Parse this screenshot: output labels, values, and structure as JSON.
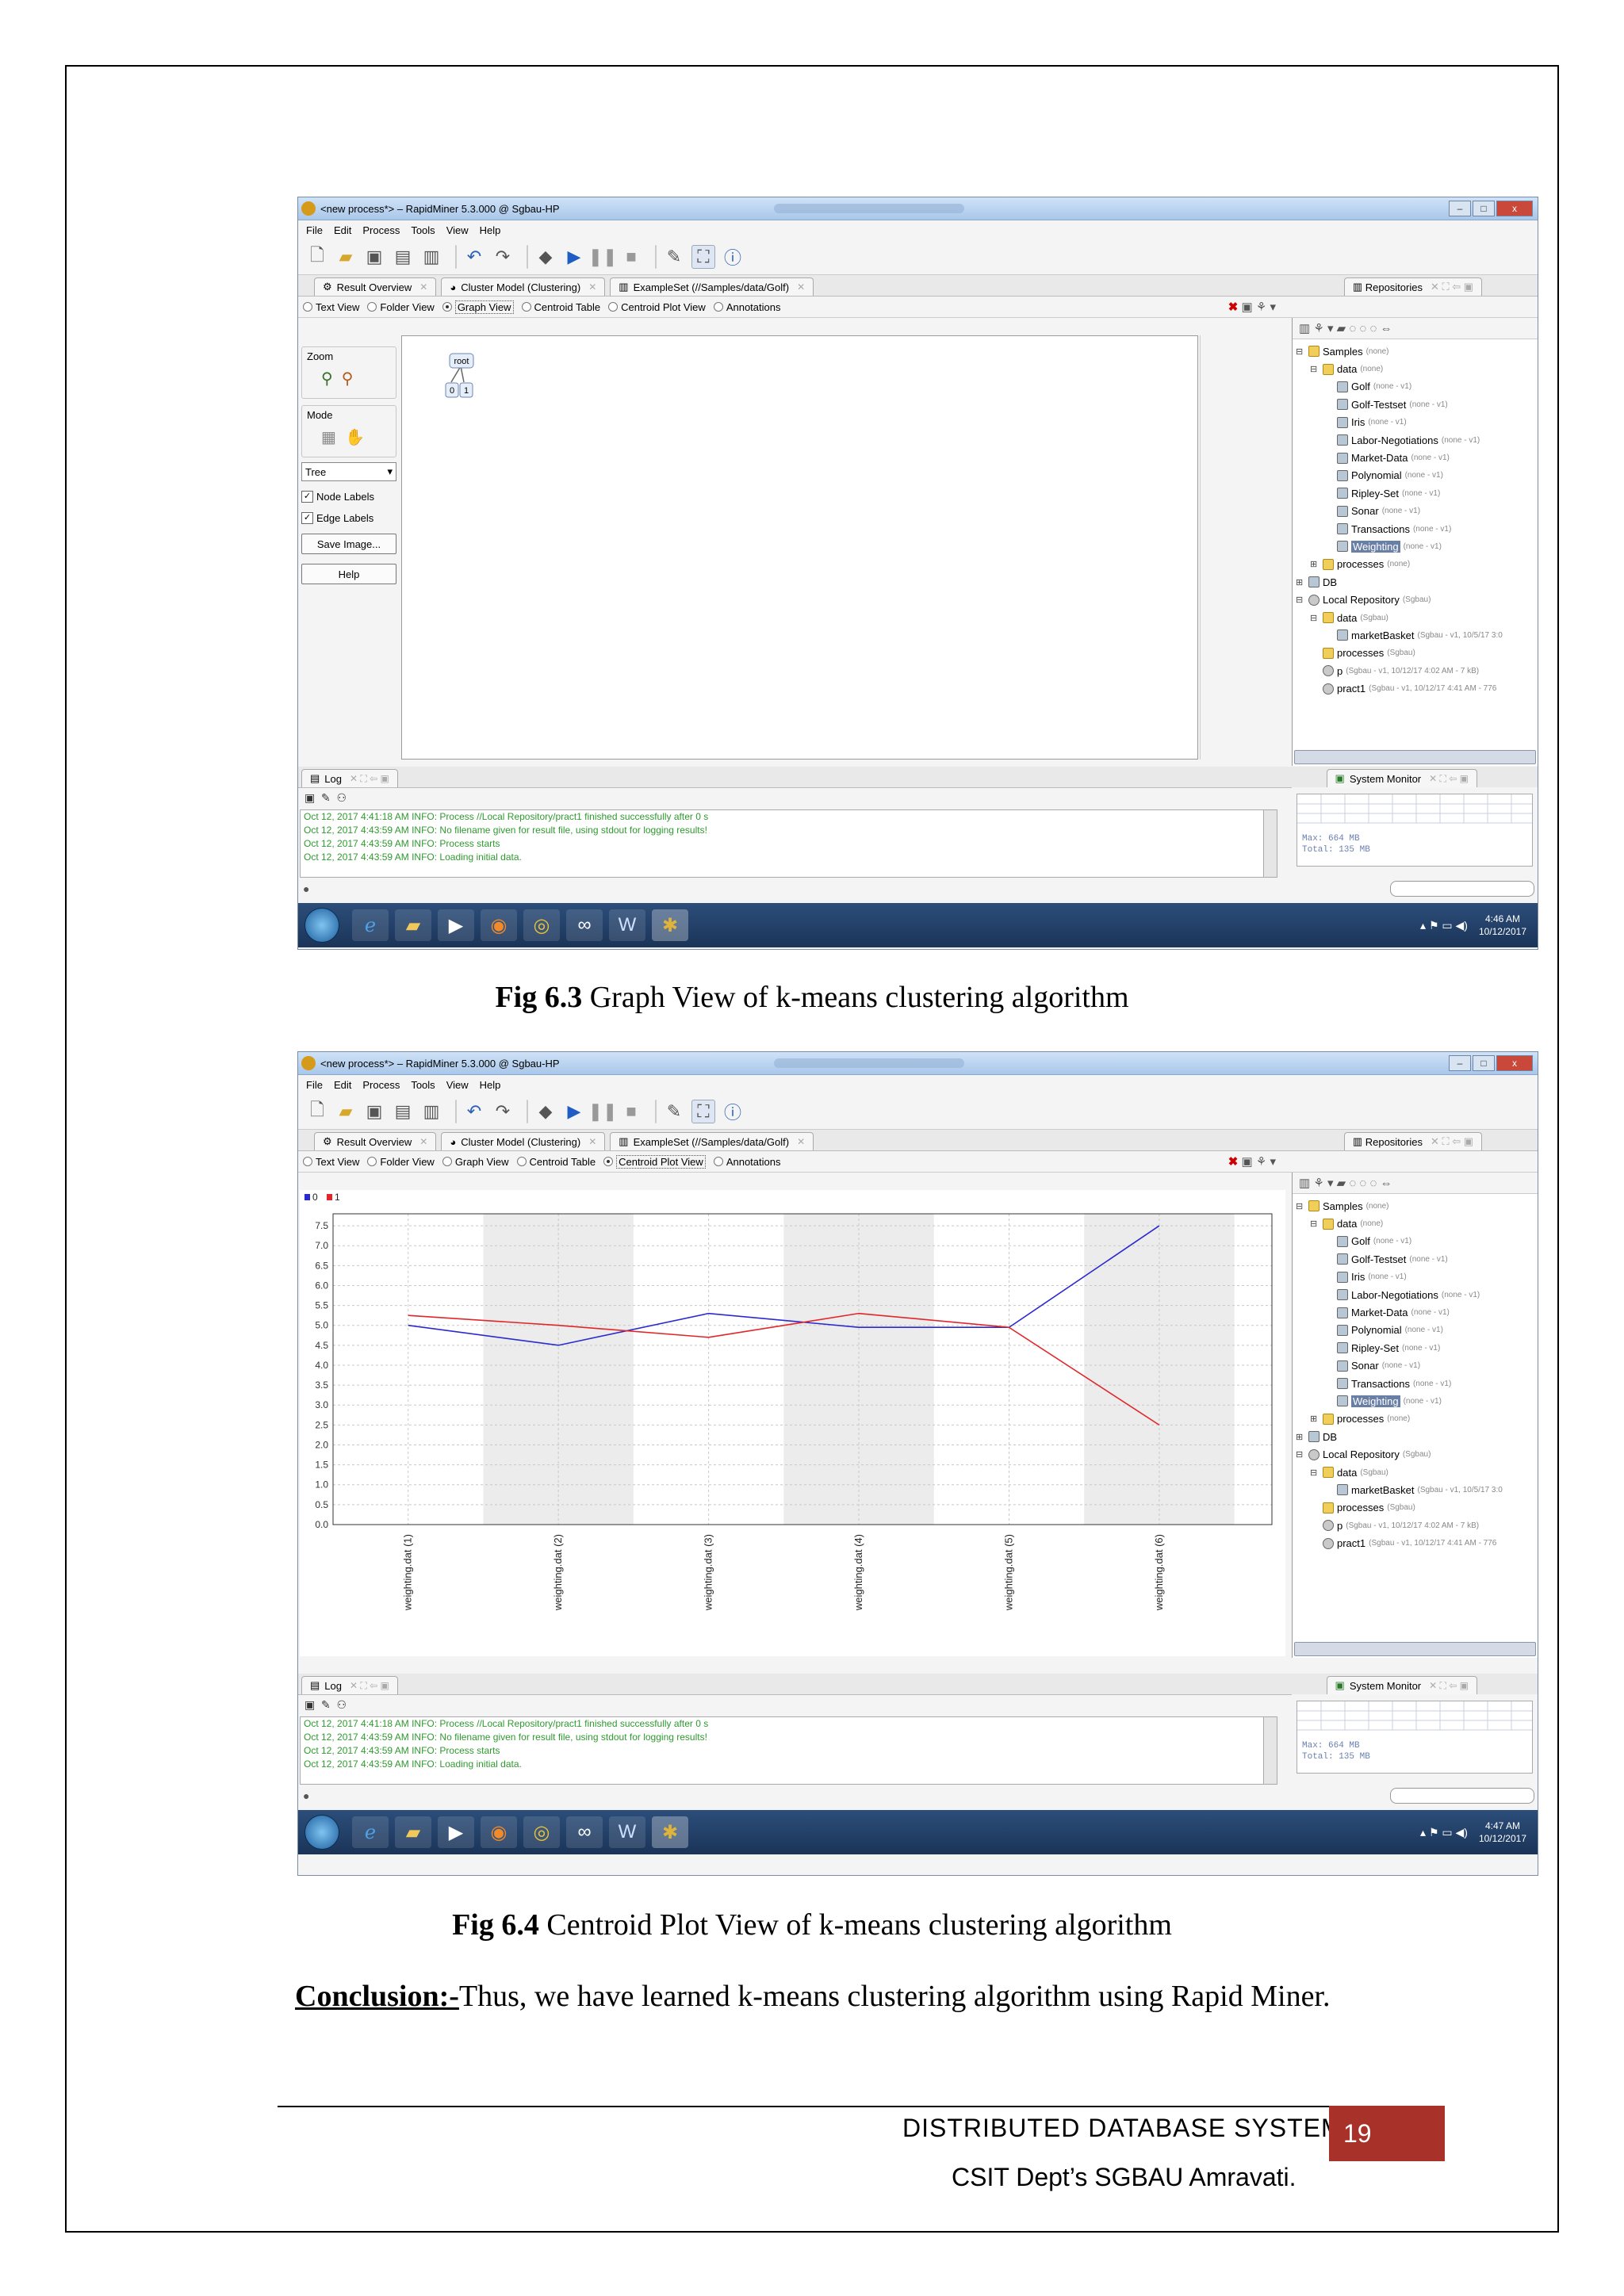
{
  "window": {
    "title": "<new process*> – RapidMiner 5.3.000 @ Sgbau-HP",
    "minimize": "–",
    "maximize": "□",
    "close": "x"
  },
  "menu": [
    "File",
    "Edit",
    "Process",
    "Tools",
    "View",
    "Help"
  ],
  "tabs": [
    {
      "label": "Result Overview",
      "icon": "result-overview-icon"
    },
    {
      "label": "Cluster Model (Clustering)",
      "icon": "cluster-model-icon"
    },
    {
      "label": "ExampleSet (//Samples/data/Golf)",
      "icon": "exampleset-icon"
    }
  ],
  "view_options": [
    "Text View",
    "Folder View",
    "Graph View",
    "Centroid Table",
    "Centroid Plot View",
    "Annotations"
  ],
  "left_panel": {
    "zoom_label": "Zoom",
    "mode_label": "Mode",
    "layout_select": "Tree",
    "node_labels": "Node Labels",
    "edge_labels": "Edge Labels",
    "save_image": "Save Image...",
    "help": "Help"
  },
  "graph": {
    "root": "root",
    "children": [
      "0",
      "1"
    ]
  },
  "repository": {
    "tab_label": "Repositories",
    "tree": [
      {
        "label": "Samples",
        "meta": "(none)",
        "level": 0,
        "type": "folder",
        "exp": "⊟"
      },
      {
        "label": "data",
        "meta": "(none)",
        "level": 1,
        "type": "folder",
        "exp": "⊟"
      },
      {
        "label": "Golf",
        "meta": "(none - v1)",
        "level": 2,
        "type": "db",
        "exp": ""
      },
      {
        "label": "Golf-Testset",
        "meta": "(none - v1)",
        "level": 2,
        "type": "db",
        "exp": ""
      },
      {
        "label": "Iris",
        "meta": "(none - v1)",
        "level": 2,
        "type": "db",
        "exp": ""
      },
      {
        "label": "Labor-Negotiations",
        "meta": "(none - v1)",
        "level": 2,
        "type": "db",
        "exp": ""
      },
      {
        "label": "Market-Data",
        "meta": "(none - v1)",
        "level": 2,
        "type": "db",
        "exp": ""
      },
      {
        "label": "Polynomial",
        "meta": "(none - v1)",
        "level": 2,
        "type": "db",
        "exp": ""
      },
      {
        "label": "Ripley-Set",
        "meta": "(none - v1)",
        "level": 2,
        "type": "db",
        "exp": ""
      },
      {
        "label": "Sonar",
        "meta": "(none - v1)",
        "level": 2,
        "type": "db",
        "exp": ""
      },
      {
        "label": "Transactions",
        "meta": "(none - v1)",
        "level": 2,
        "type": "db",
        "exp": ""
      },
      {
        "label": "Weighting",
        "meta": "(none - v1)",
        "level": 2,
        "type": "db",
        "exp": "",
        "selected": true
      },
      {
        "label": "processes",
        "meta": "(none)",
        "level": 1,
        "type": "folder",
        "exp": "⊞"
      },
      {
        "label": "DB",
        "meta": "",
        "level": 0,
        "type": "db",
        "exp": "⊞"
      },
      {
        "label": "Local Repository",
        "meta": "(Sgbau)",
        "level": 0,
        "type": "proc",
        "exp": "⊟"
      },
      {
        "label": "data",
        "meta": "(Sgbau)",
        "level": 1,
        "type": "folder",
        "exp": "⊟"
      },
      {
        "label": "marketBasket",
        "meta": "(Sgbau - v1, 10/5/17 3:0",
        "level": 2,
        "type": "db",
        "exp": ""
      },
      {
        "label": "processes",
        "meta": "(Sgbau)",
        "level": 1,
        "type": "folder",
        "exp": ""
      },
      {
        "label": "p",
        "meta": "(Sgbau - v1, 10/12/17 4:02 AM - 7 kB)",
        "level": 1,
        "type": "proc",
        "exp": ""
      },
      {
        "label": "pract1",
        "meta": "(Sgbau - v1, 10/12/17 4:41 AM - 776",
        "level": 1,
        "type": "proc",
        "exp": ""
      }
    ]
  },
  "log": {
    "tab_label": "Log",
    "lines": [
      "Oct 12, 2017 4:41:18 AM INFO: Process //Local Repository/pract1 finished successfully after 0 s",
      "Oct 12, 2017 4:43:59 AM INFO: No filename given for result file, using stdout for logging results!",
      "Oct 12, 2017 4:43:59 AM INFO: Process starts",
      "Oct 12, 2017 4:43:59 AM INFO: Loading initial data."
    ]
  },
  "system_monitor": {
    "tab_label": "System Monitor",
    "max": "Max:   664 MB",
    "total": "Total: 135 MB"
  },
  "shot1": {
    "selected_view": "Graph View",
    "clock_time": "4:46 AM",
    "clock_date": "10/12/2017"
  },
  "shot2": {
    "selected_view": "Centroid Plot View",
    "clock_time": "4:47 AM",
    "clock_date": "10/12/2017"
  },
  "chart_data": {
    "type": "line",
    "categories": [
      "weighting.dat (1)",
      "weighting.dat (2)",
      "weighting.dat (3)",
      "weighting.dat (4)",
      "weighting.dat (5)",
      "weighting.dat (6)"
    ],
    "series": [
      {
        "name": "0",
        "color": "#2a2ad0",
        "values": [
          5.0,
          4.5,
          5.3,
          4.95,
          4.95,
          7.5
        ]
      },
      {
        "name": "1",
        "color": "#e0262a",
        "values": [
          5.25,
          5.0,
          4.7,
          5.3,
          4.95,
          2.5
        ]
      }
    ],
    "ylim": [
      0,
      7.8
    ],
    "yticks": [
      "0.0",
      "0.5",
      "1.0",
      "1.5",
      "2.0",
      "2.5",
      "3.0",
      "3.5",
      "4.0",
      "4.5",
      "5.0",
      "5.5",
      "6.0",
      "6.5",
      "7.0",
      "7.5"
    ],
    "legend_position": "top-left",
    "grid": true,
    "alternating_bands": true
  },
  "captions": {
    "fig63_num": "Fig 6.3",
    "fig63_text": " Graph View of k-means clustering algorithm",
    "fig64_num": "Fig 6.4",
    "fig64_text": " Centroid Plot View of k-means clustering algorithm"
  },
  "conclusion": {
    "heading": "Conclusion:-",
    "text": "Thus, we have learned k-means clustering algorithm using Rapid Miner."
  },
  "footer": {
    "title": "DISTRIBUTED  DATABASE SYSTEM",
    "page": "19",
    "dept": "CSIT Dept’s SGBAU Amravati."
  }
}
